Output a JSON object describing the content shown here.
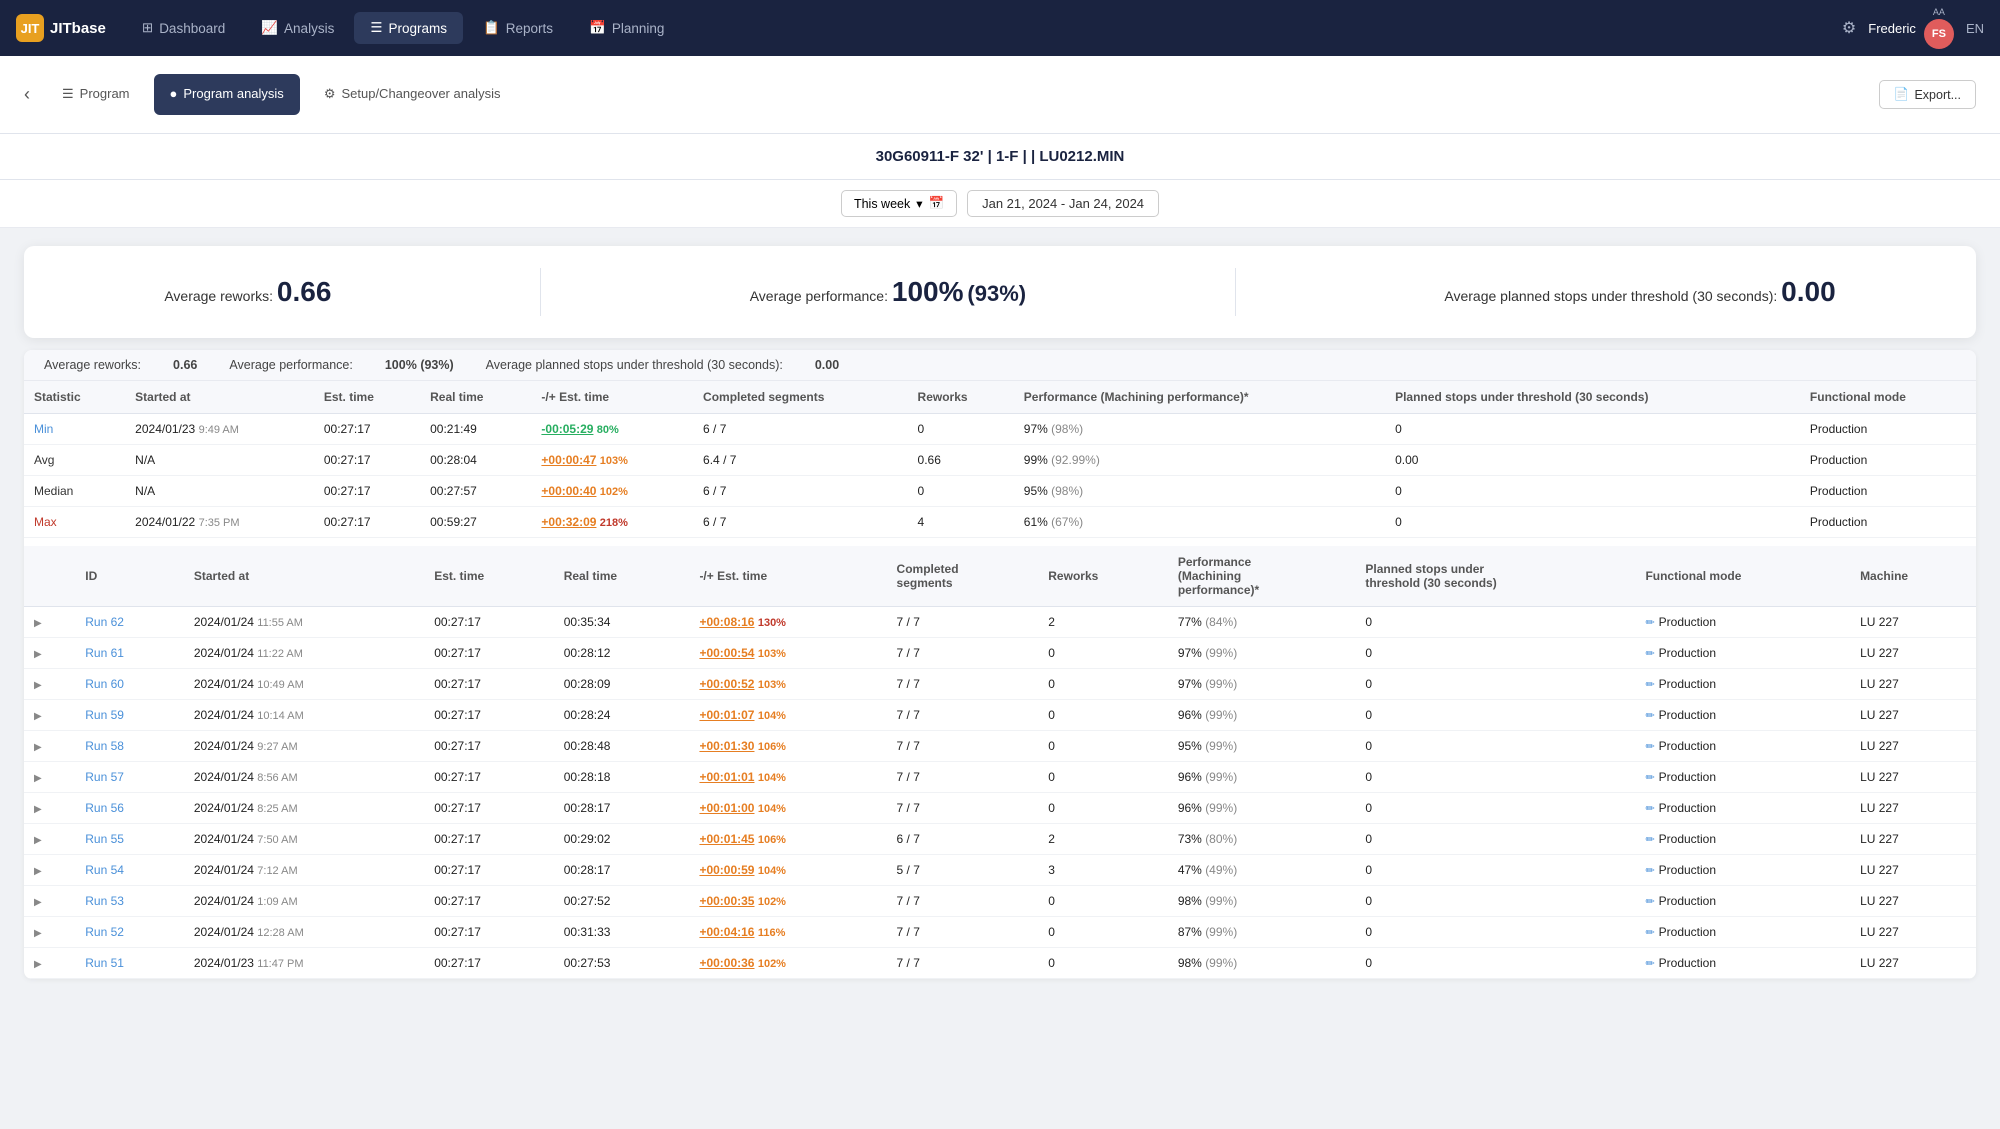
{
  "app": {
    "logo_text": "JITbase",
    "logo_abbr": "JIT"
  },
  "nav": {
    "items": [
      {
        "label": "Dashboard",
        "icon": "⊞",
        "active": false
      },
      {
        "label": "Analysis",
        "icon": "📈",
        "active": false
      },
      {
        "label": "Programs",
        "icon": "☰",
        "active": true
      },
      {
        "label": "Reports",
        "icon": "📋",
        "active": false
      },
      {
        "label": "Planning",
        "icon": "📅",
        "active": false
      }
    ],
    "user_name": "Frederic",
    "user_initials_aa": "AA",
    "user_initials_fs": "FS",
    "lang": "EN"
  },
  "page_title": "30G60911-F 32' | 1-F |  | LU0212.MIN",
  "sub_nav": {
    "items": [
      {
        "label": "Program",
        "icon": "☰",
        "active": false
      },
      {
        "label": "Program analysis",
        "icon": "●",
        "active": true
      },
      {
        "label": "Setup/Changeover analysis",
        "icon": "⚙",
        "active": false
      }
    ]
  },
  "export_label": "Export...",
  "date_picker": {
    "preset_label": "This week",
    "start": "Jan 21, 2024",
    "separator": "-",
    "end": "Jan 24, 2024"
  },
  "summary": {
    "reworks_label": "Average reworks:",
    "reworks_value": "0.66",
    "performance_label": "Average performance:",
    "performance_value": "100%",
    "performance_paren": "(93%)",
    "stops_label": "Average planned stops under threshold (30 seconds):",
    "stops_value": "0.00"
  },
  "table_summary": {
    "reworks_label": "Average reworks:",
    "reworks_value": "0.66",
    "performance_label": "Average performance:",
    "performance_value": "100%",
    "performance_paren": "(93%)",
    "stops_label": "Average planned stops under threshold (30 seconds):",
    "stops_value": "0.00"
  },
  "stats_table": {
    "headers": [
      "Statistic",
      "Started at",
      "Est. time",
      "Real time",
      "-/+ Est. time",
      "Completed segments",
      "Reworks",
      "Performance (Machining performance)*",
      "Planned stops under threshold (30 seconds)",
      "Functional mode"
    ],
    "rows": [
      {
        "stat": "Min",
        "stat_class": "min",
        "started_at": "2024/01/23",
        "time_str": "9:49 AM",
        "est_time": "00:27:17",
        "real_time": "00:21:49",
        "delta": "-00:05:29",
        "delta_pct": "80%",
        "delta_class": "negative",
        "pct_class": "pct-green",
        "completed": "6 / 7",
        "reworks": "0",
        "performance": "97%",
        "mach_perf": "(98%)",
        "planned_stops": "0",
        "func_mode": "Production"
      },
      {
        "stat": "Avg",
        "stat_class": "avg",
        "started_at": "N/A",
        "time_str": "",
        "est_time": "00:27:17",
        "real_time": "00:28:04",
        "delta": "+00:00:47",
        "delta_pct": "103%",
        "delta_class": "positive",
        "pct_class": "pct-orange",
        "completed": "6.4 / 7",
        "reworks": "0.66",
        "performance": "99%",
        "mach_perf": "(92.99%)",
        "planned_stops": "0.00",
        "func_mode": "Production"
      },
      {
        "stat": "Median",
        "stat_class": "median",
        "started_at": "N/A",
        "time_str": "",
        "est_time": "00:27:17",
        "real_time": "00:27:57",
        "delta": "+00:00:40",
        "delta_pct": "102%",
        "delta_class": "positive",
        "pct_class": "pct-orange",
        "completed": "6 / 7",
        "reworks": "0",
        "performance": "95%",
        "mach_perf": "(98%)",
        "planned_stops": "0",
        "func_mode": "Production"
      },
      {
        "stat": "Max",
        "stat_class": "max",
        "started_at": "2024/01/22",
        "time_str": "7:35 PM",
        "est_time": "00:27:17",
        "real_time": "00:59:27",
        "delta": "+00:32:09",
        "delta_pct": "218%",
        "delta_class": "positive",
        "pct_class": "pct-red",
        "completed": "6 / 7",
        "reworks": "4",
        "performance": "61%",
        "mach_perf": "(67%)",
        "planned_stops": "0",
        "func_mode": "Production"
      }
    ]
  },
  "runs_table": {
    "headers": [
      "ID",
      "Started at",
      "Est. time",
      "Real time",
      "-/+ Est. time",
      "Completed segments",
      "Reworks",
      "Performance (Machining performance)*",
      "Planned stops under threshold (30 seconds)",
      "Functional mode",
      "Machine"
    ],
    "rows": [
      {
        "id": "Run 62",
        "date": "2024/01/24",
        "time_str": "11:55 AM",
        "est": "00:27:17",
        "real": "00:35:34",
        "delta": "+00:08:16",
        "pct": "130%",
        "delta_class": "positive",
        "pct_class": "pct-red",
        "completed": "7 / 7",
        "reworks": "2",
        "perf": "77%",
        "mach_perf": "(84%)",
        "stops": "0",
        "func_mode": "Production",
        "machine": "LU 227"
      },
      {
        "id": "Run 61",
        "date": "2024/01/24",
        "time_str": "11:22 AM",
        "est": "00:27:17",
        "real": "00:28:12",
        "delta": "+00:00:54",
        "pct": "103%",
        "delta_class": "positive",
        "pct_class": "pct-orange",
        "completed": "7 / 7",
        "reworks": "0",
        "perf": "97%",
        "mach_perf": "(99%)",
        "stops": "0",
        "func_mode": "Production",
        "machine": "LU 227"
      },
      {
        "id": "Run 60",
        "date": "2024/01/24",
        "time_str": "10:49 AM",
        "est": "00:27:17",
        "real": "00:28:09",
        "delta": "+00:00:52",
        "pct": "103%",
        "delta_class": "positive",
        "pct_class": "pct-orange",
        "completed": "7 / 7",
        "reworks": "0",
        "perf": "97%",
        "mach_perf": "(99%)",
        "stops": "0",
        "func_mode": "Production",
        "machine": "LU 227"
      },
      {
        "id": "Run 59",
        "date": "2024/01/24",
        "time_str": "10:14 AM",
        "est": "00:27:17",
        "real": "00:28:24",
        "delta": "+00:01:07",
        "pct": "104%",
        "delta_class": "positive",
        "pct_class": "pct-orange",
        "completed": "7 / 7",
        "reworks": "0",
        "perf": "96%",
        "mach_perf": "(99%)",
        "stops": "0",
        "func_mode": "Production",
        "machine": "LU 227"
      },
      {
        "id": "Run 58",
        "date": "2024/01/24",
        "time_str": "9:27 AM",
        "est": "00:27:17",
        "real": "00:28:48",
        "delta": "+00:01:30",
        "pct": "106%",
        "delta_class": "positive",
        "pct_class": "pct-orange",
        "completed": "7 / 7",
        "reworks": "0",
        "perf": "95%",
        "mach_perf": "(99%)",
        "stops": "0",
        "func_mode": "Production",
        "machine": "LU 227"
      },
      {
        "id": "Run 57",
        "date": "2024/01/24",
        "time_str": "8:56 AM",
        "est": "00:27:17",
        "real": "00:28:18",
        "delta": "+00:01:01",
        "pct": "104%",
        "delta_class": "positive",
        "pct_class": "pct-orange",
        "completed": "7 / 7",
        "reworks": "0",
        "perf": "96%",
        "mach_perf": "(99%)",
        "stops": "0",
        "func_mode": "Production",
        "machine": "LU 227"
      },
      {
        "id": "Run 56",
        "date": "2024/01/24",
        "time_str": "8:25 AM",
        "est": "00:27:17",
        "real": "00:28:17",
        "delta": "+00:01:00",
        "pct": "104%",
        "delta_class": "positive",
        "pct_class": "pct-orange",
        "completed": "7 / 7",
        "reworks": "0",
        "perf": "96%",
        "mach_perf": "(99%)",
        "stops": "0",
        "func_mode": "Production",
        "machine": "LU 227"
      },
      {
        "id": "Run 55",
        "date": "2024/01/24",
        "time_str": "7:50 AM",
        "est": "00:27:17",
        "real": "00:29:02",
        "delta": "+00:01:45",
        "pct": "106%",
        "delta_class": "positive",
        "pct_class": "pct-orange",
        "completed": "6 / 7",
        "reworks": "2",
        "perf": "73%",
        "mach_perf": "(80%)",
        "stops": "0",
        "func_mode": "Production",
        "machine": "LU 227"
      },
      {
        "id": "Run 54",
        "date": "2024/01/24",
        "time_str": "7:12 AM",
        "est": "00:27:17",
        "real": "00:28:17",
        "delta": "+00:00:59",
        "pct": "104%",
        "delta_class": "positive",
        "pct_class": "pct-orange",
        "completed": "5 / 7",
        "reworks": "3",
        "perf": "47%",
        "mach_perf": "(49%)",
        "stops": "0",
        "func_mode": "Production",
        "machine": "LU 227"
      },
      {
        "id": "Run 53",
        "date": "2024/01/24",
        "time_str": "1:09 AM",
        "est": "00:27:17",
        "real": "00:27:52",
        "delta": "+00:00:35",
        "pct": "102%",
        "delta_class": "positive",
        "pct_class": "pct-orange",
        "completed": "7 / 7",
        "reworks": "0",
        "perf": "98%",
        "mach_perf": "(99%)",
        "stops": "0",
        "func_mode": "Production",
        "machine": "LU 227"
      },
      {
        "id": "Run 52",
        "date": "2024/01/24",
        "time_str": "12:28 AM",
        "est": "00:27:17",
        "real": "00:31:33",
        "delta": "+00:04:16",
        "pct": "116%",
        "delta_class": "positive",
        "pct_class": "pct-orange",
        "completed": "7 / 7",
        "reworks": "0",
        "perf": "87%",
        "mach_perf": "(99%)",
        "stops": "0",
        "func_mode": "Production",
        "machine": "LU 227"
      },
      {
        "id": "Run 51",
        "date": "2024/01/23",
        "time_str": "11:47 PM",
        "est": "00:27:17",
        "real": "00:27:53",
        "delta": "+00:00:36",
        "pct": "102%",
        "delta_class": "positive",
        "pct_class": "pct-orange",
        "completed": "7 / 7",
        "reworks": "0",
        "perf": "98%",
        "mach_perf": "(99%)",
        "stops": "0",
        "func_mode": "Production",
        "machine": "LU 227"
      }
    ]
  }
}
